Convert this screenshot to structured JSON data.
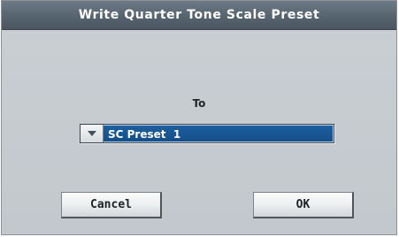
{
  "dialog": {
    "title": "Write Quarter Tone Scale Preset",
    "to_label": "To",
    "target_select": {
      "selected_value": "SC Preset  1"
    },
    "buttons": {
      "cancel_label": "Cancel",
      "ok_label": "OK"
    },
    "icons": {
      "dropdown": "chevron-down-icon"
    },
    "colors": {
      "title_bar": "#566470",
      "background": "#c5cacf",
      "selection": "#1a5894"
    }
  }
}
